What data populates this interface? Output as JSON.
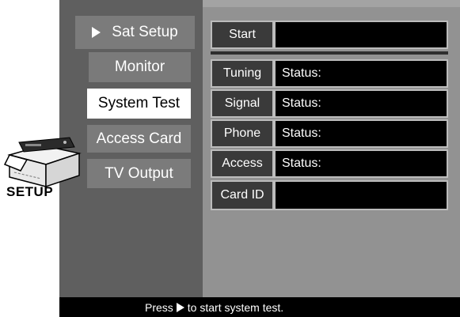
{
  "menu": {
    "items": [
      {
        "label": "Sat Setup",
        "state": "current"
      },
      {
        "label": "Monitor",
        "state": "dim"
      },
      {
        "label": "System Test",
        "state": "selected"
      },
      {
        "label": "Access Card",
        "state": "normal"
      },
      {
        "label": "TV Output",
        "state": "normal"
      }
    ]
  },
  "logo": {
    "text": "SETUP",
    "icon": "setup-box-icon"
  },
  "panel": {
    "start": {
      "label": "Start",
      "value": ""
    },
    "rows": [
      {
        "label": "Tuning",
        "value": "Status:"
      },
      {
        "label": "Signal",
        "value": "Status:"
      },
      {
        "label": "Phone",
        "value": "Status:"
      },
      {
        "label": "Access",
        "value": "Status:"
      },
      {
        "label": "Card ID",
        "value": ""
      }
    ]
  },
  "status_bar": {
    "prefix": "Press",
    "icon": "play-icon",
    "suffix": "to start system test."
  },
  "colors": {
    "sidebar": "#5f5f5f",
    "panel": "#929292",
    "menu_item": "#7b7b7b",
    "selected_bg": "#ffffff",
    "label_cell": "#3a3a3a",
    "value_cell": "#000000",
    "status_bar": "#000000"
  }
}
